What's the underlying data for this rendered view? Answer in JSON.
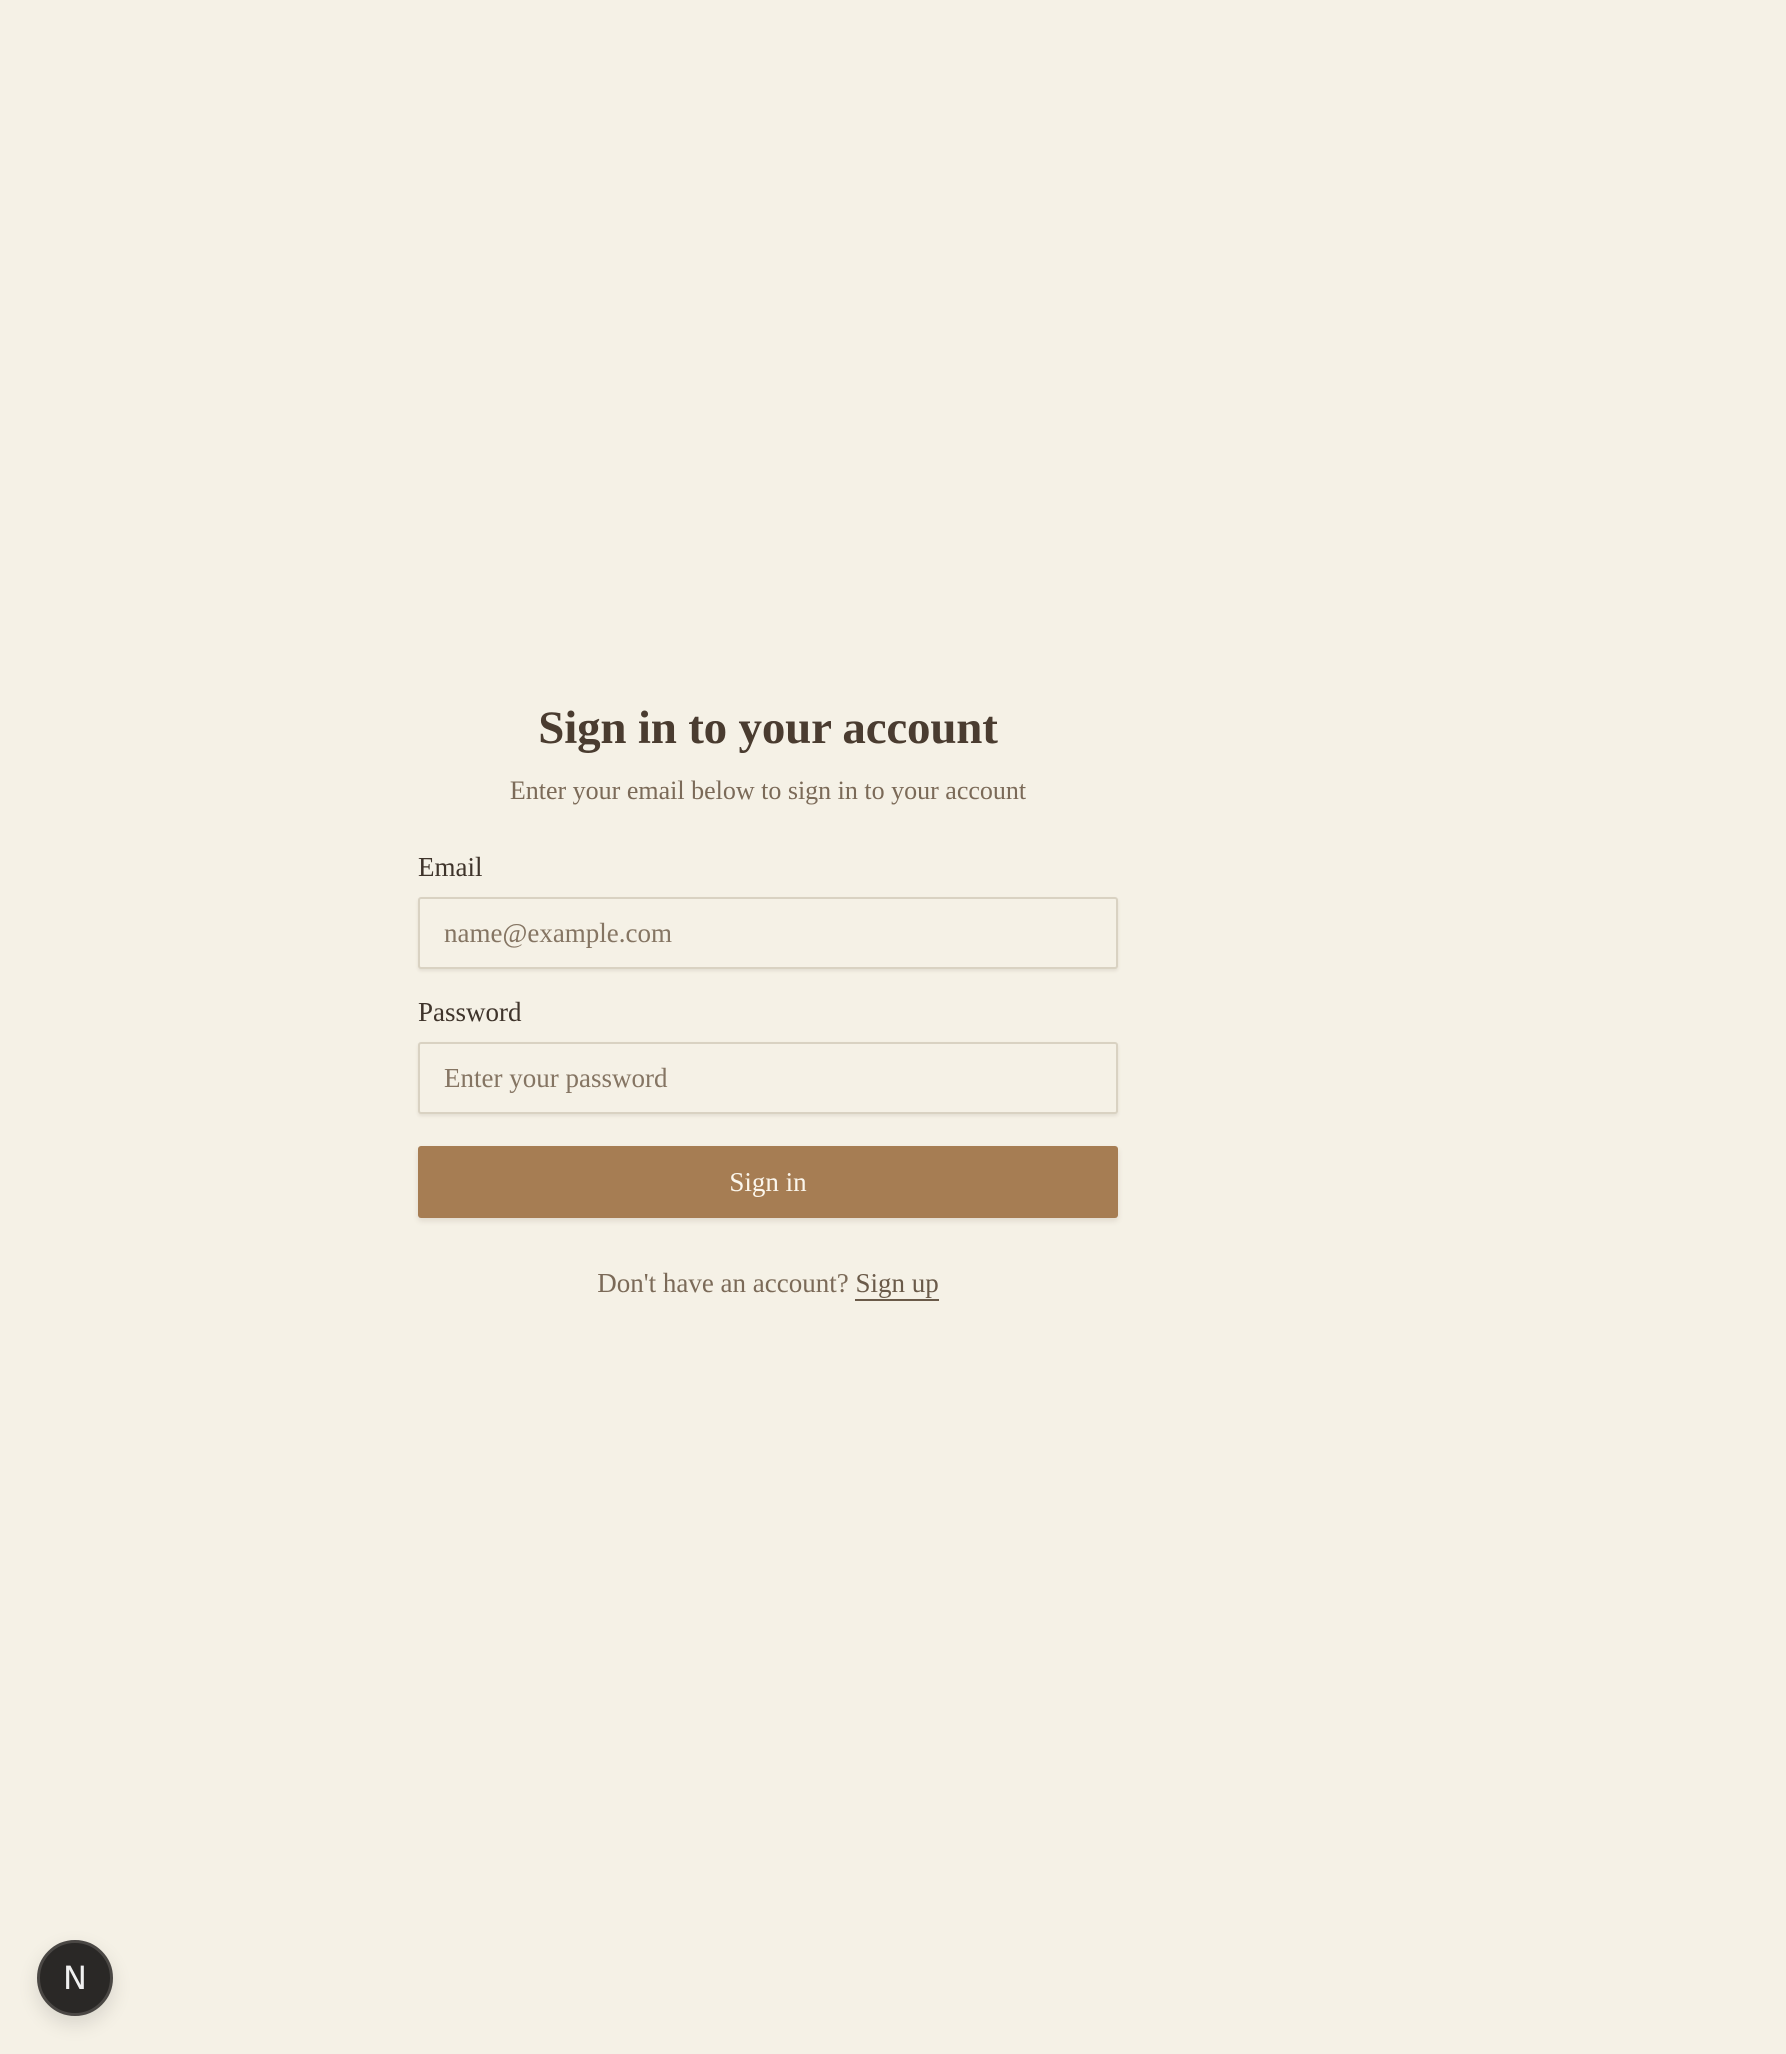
{
  "auth": {
    "title": "Sign in to your account",
    "subtitle": "Enter your email below to sign in to your account",
    "email": {
      "label": "Email",
      "placeholder": "name@example.com",
      "value": ""
    },
    "password": {
      "label": "Password",
      "placeholder": "Enter your password",
      "value": ""
    },
    "submit_label": "Sign in",
    "signup_prompt": "Don't have an account?",
    "signup_link": "Sign up"
  },
  "devtools": {
    "badge_letter": "N",
    "icon": "nextjs-logo-icon"
  },
  "colors": {
    "background": "#f5f1e6",
    "accent": "#a67d53",
    "heading": "#4a3c30",
    "muted": "#7b6a58"
  }
}
